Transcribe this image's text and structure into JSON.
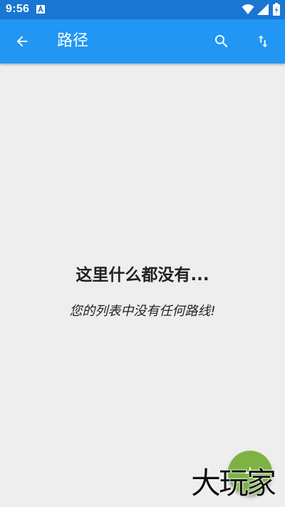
{
  "status_bar": {
    "time": "9:56",
    "icons": [
      "notification-a-icon",
      "wifi-icon",
      "signal-icon",
      "battery-icon"
    ]
  },
  "app_bar": {
    "title": "路径",
    "back_icon": "arrow-back-icon",
    "search_icon": "search-icon",
    "sort_icon": "swap-vert-icon",
    "color": "#2196f3"
  },
  "empty_state": {
    "title": "这里什么都没有...",
    "subtitle": "您的列表中没有任何路线!"
  },
  "fab": {
    "icon": "plus-icon",
    "color": "#7cb342"
  },
  "watermark": {
    "text": "大玩家"
  }
}
